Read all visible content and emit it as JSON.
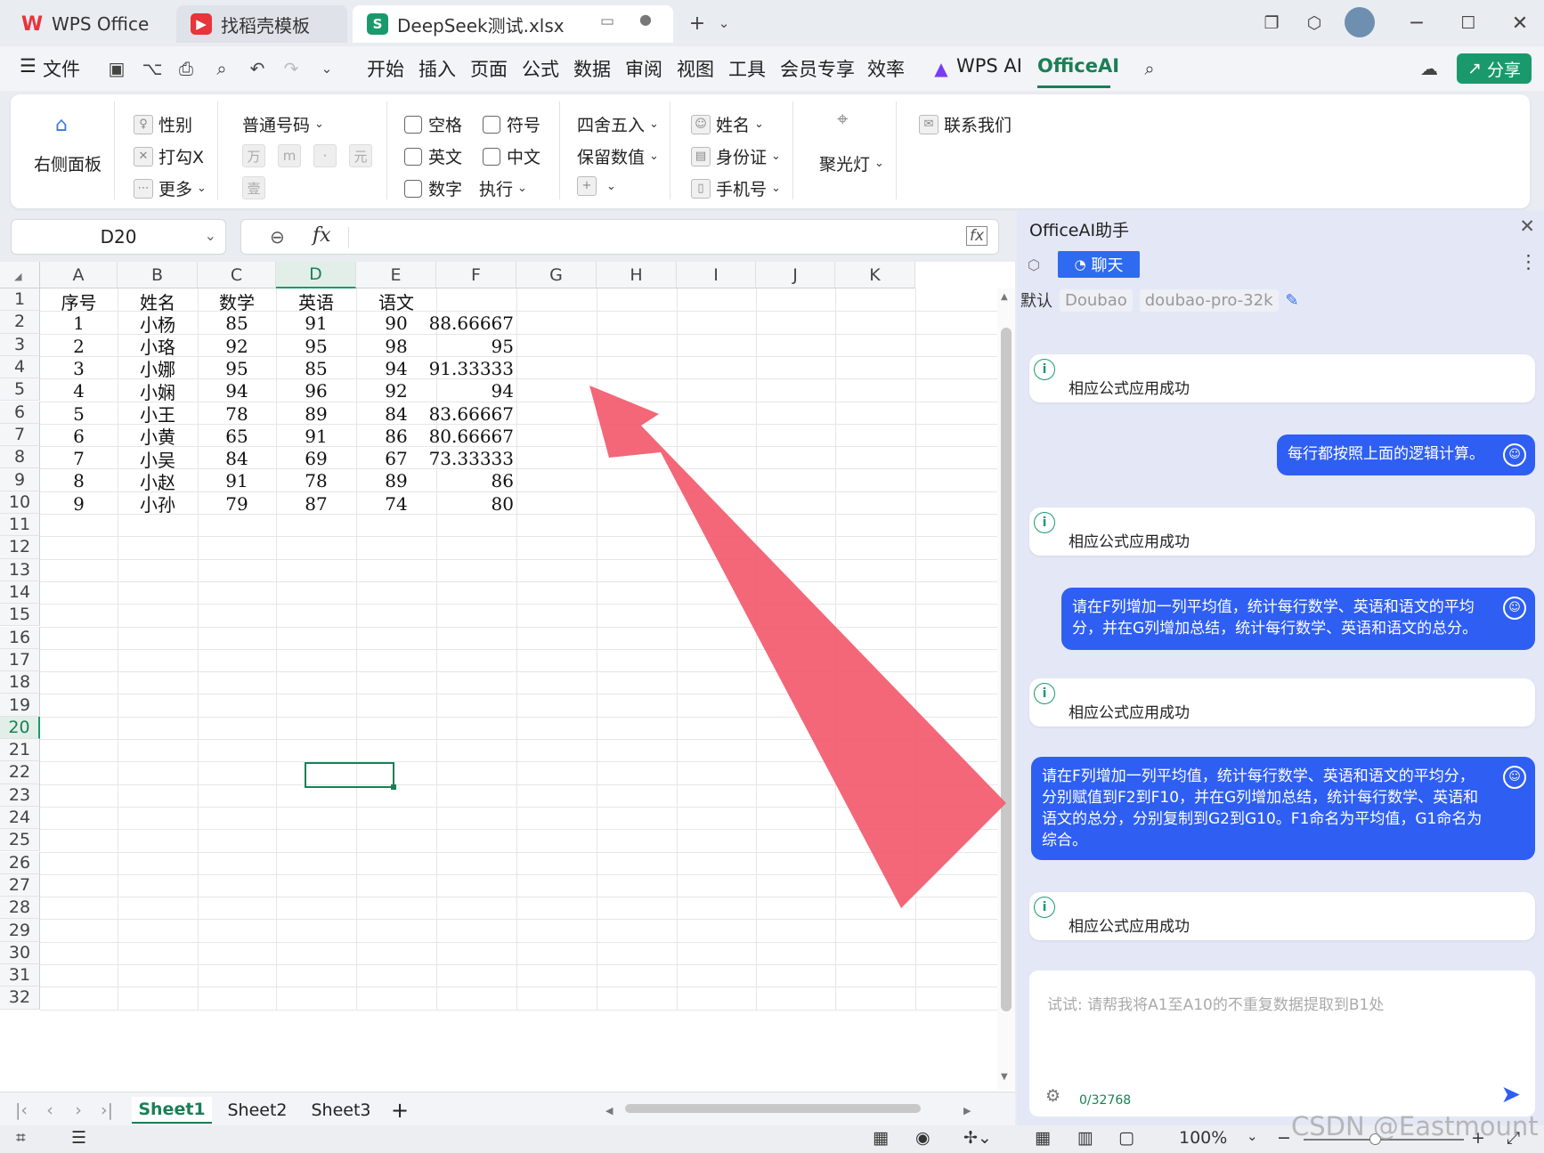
{
  "window": {
    "tabs": [
      {
        "label": "WPS Office",
        "icon": "wps-logo-icon"
      },
      {
        "label": "找稻壳模板",
        "icon": "docer-icon"
      },
      {
        "label": "DeepSeek测试.xlsx",
        "icon": "spreadsheet-icon"
      }
    ]
  },
  "menubar": {
    "file": "文件",
    "items": [
      "开始",
      "插入",
      "页面",
      "公式",
      "数据",
      "审阅",
      "视图",
      "工具",
      "会员专享",
      "效率"
    ],
    "wps_ai": "WPS AI",
    "officeai": "OfficeAI",
    "share": "分享"
  },
  "ribbon": {
    "right_panel": "右侧面板",
    "gender": "性别",
    "tick_x": "打勾X",
    "more": "更多",
    "number_type": "普通号码",
    "num_glyphs": [
      "万",
      "m",
      "·",
      "元",
      "壹"
    ],
    "checks": [
      "空格",
      "英文",
      "数字",
      "符号",
      "中文"
    ],
    "execute": "执行",
    "rounding": "四舍五入",
    "keep_value": "保留数值",
    "name": "姓名",
    "id_card": "身份证",
    "phone": "手机号",
    "spotlight": "聚光灯",
    "contact": "联系我们"
  },
  "formula_bar": {
    "cell_ref": "D20",
    "fx": "fx",
    "content": ""
  },
  "sheet": {
    "columns": [
      "A",
      "B",
      "C",
      "D",
      "E",
      "F",
      "G",
      "H",
      "I",
      "J",
      "K"
    ],
    "selected_column": "D",
    "selected_row": "20",
    "row_numbers": [
      "1",
      "2",
      "3",
      "4",
      "5",
      "6",
      "7",
      "8",
      "9",
      "10",
      "11",
      "12",
      "13",
      "14",
      "15",
      "16",
      "17",
      "18",
      "19",
      "20",
      "21",
      "22",
      "23",
      "24",
      "25",
      "26",
      "27",
      "28",
      "29",
      "30",
      "31",
      "32"
    ],
    "header_row": [
      "序号",
      "姓名",
      "数学",
      "英语",
      "语文"
    ],
    "rows": [
      [
        "1",
        "小杨",
        "85",
        "91",
        "90",
        "88.66667"
      ],
      [
        "2",
        "小珞",
        "92",
        "95",
        "98",
        "95"
      ],
      [
        "3",
        "小娜",
        "95",
        "85",
        "94",
        "91.33333"
      ],
      [
        "4",
        "小娴",
        "94",
        "96",
        "92",
        "94"
      ],
      [
        "5",
        "小王",
        "78",
        "89",
        "84",
        "83.66667"
      ],
      [
        "6",
        "小黄",
        "65",
        "91",
        "86",
        "80.66667"
      ],
      [
        "7",
        "小吴",
        "84",
        "69",
        "67",
        "73.33333"
      ],
      [
        "8",
        "小赵",
        "91",
        "78",
        "89",
        "86"
      ],
      [
        "9",
        "小孙",
        "79",
        "87",
        "74",
        "80"
      ]
    ],
    "sheet_tabs": [
      "Sheet1",
      "Sheet2",
      "Sheet3"
    ],
    "active_sheet": "Sheet1"
  },
  "status": {
    "zoom": "100%"
  },
  "panel": {
    "title": "OfficeAI助手",
    "chat_tab": "聊天",
    "model_label": "默认",
    "provider": "Doubao",
    "model": "doubao-pro-32k",
    "messages": [
      {
        "role": "system",
        "text": "相应公式应用成功"
      },
      {
        "role": "user",
        "text": "每行都按照上面的逻辑计算。"
      },
      {
        "role": "system",
        "text": "相应公式应用成功"
      },
      {
        "role": "user",
        "text": "请在F列增加一列平均值，统计每行数学、英语和语文的平均分，并在G列增加总结，统计每行数学、英语和语文的总分。"
      },
      {
        "role": "system",
        "text": "相应公式应用成功"
      },
      {
        "role": "user",
        "text": "请在F列增加一列平均值，统计每行数学、英语和语文的平均分，分别赋值到F2到F10，并在G列增加总结，统计每行数学、英语和语文的总分，分别复制到G2到G10。F1命名为平均值，G1命名为综合。"
      },
      {
        "role": "system",
        "text": "相应公式应用成功"
      }
    ],
    "input_placeholder": "试试: 请帮我将A1至A10的不重复数据提取到B1处",
    "char_count": "0/32768"
  },
  "watermark": "CSDN @Eastmount",
  "colors": {
    "accent_green": "#1a7f55",
    "user_bubble": "#2f5ff2",
    "arrow": "#f25a6e"
  }
}
